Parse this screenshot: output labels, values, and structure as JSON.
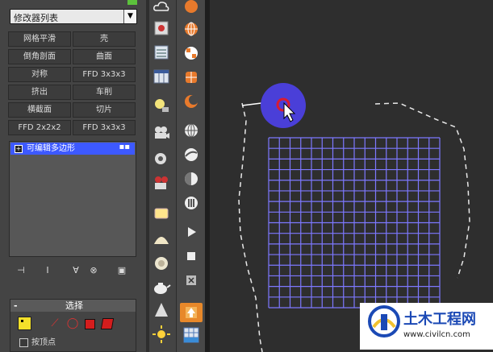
{
  "modifier_list": {
    "label": "修改器列表",
    "arrow": "▼"
  },
  "modifier_buttons": [
    [
      "网格平滑",
      "壳"
    ],
    [
      "倒角剖面",
      "曲面"
    ],
    [
      "对称",
      "FFD 3x3x3"
    ],
    [
      "挤出",
      "车削"
    ],
    [
      "横截面",
      "切片"
    ],
    [
      "FFD 2x2x2",
      "FFD 3x3x3"
    ]
  ],
  "stack": {
    "item": "可编辑多边形",
    "plus": "+",
    "dots": "▪▪"
  },
  "stack_icons": [
    "⊣",
    "Ⅰ",
    "∀",
    "⊗",
    "▣"
  ],
  "selection": {
    "title": "选择",
    "collapse": "-",
    "vertex_checkbox": "按顶点"
  },
  "watermark": {
    "title": "土木工程网",
    "url": "www.civilcn.com"
  },
  "colors": {
    "accent_blue": "#3d59ff",
    "orange": "#e7882a",
    "grid": "#7d78ff",
    "watermark_blue": "#1b49b5"
  },
  "viewport_grid": {
    "columns": 16,
    "rows": 16
  }
}
